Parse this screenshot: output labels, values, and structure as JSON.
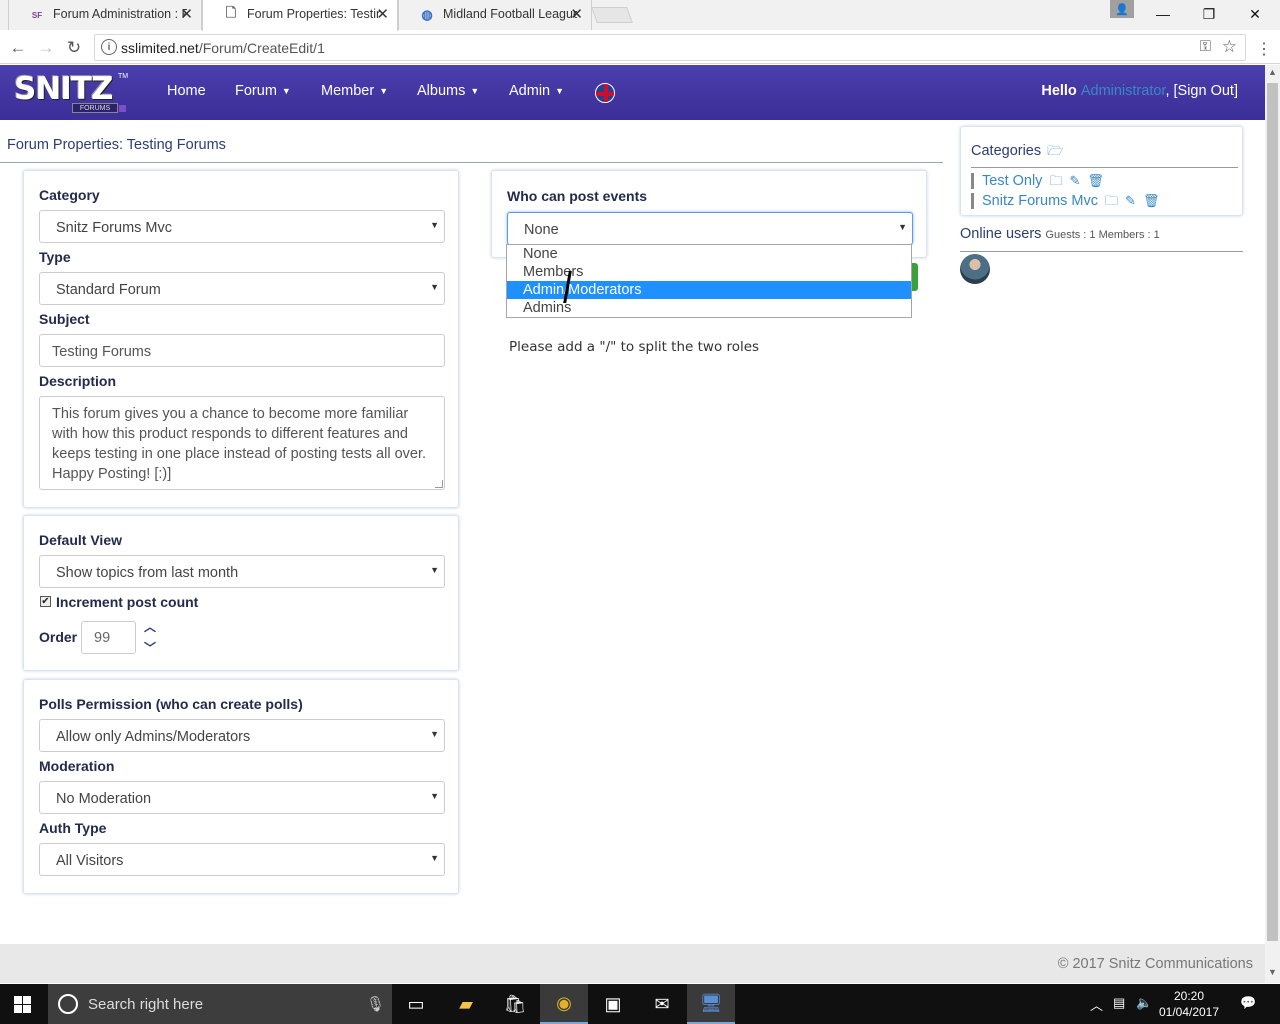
{
  "browser": {
    "tabs": [
      {
        "label": "Forum Administration : F",
        "favicon": "SF"
      },
      {
        "label": "Forum Properties: Testing",
        "active": true
      },
      {
        "label": "Midland Football League"
      }
    ],
    "url_domain": "sslimited.net",
    "url_path": "/Forum/CreateEdit/1"
  },
  "nav": {
    "logo_text": "SNITZ",
    "logo_sub": "FORUMS",
    "logo_tm": "TM",
    "items": [
      "Home",
      "Forum",
      "Member",
      "Albums",
      "Admin"
    ],
    "hello": "Hello",
    "user": "Administrator",
    "signout": ", [Sign Out]"
  },
  "page": {
    "title": "Forum Properties: Testing Forums"
  },
  "form": {
    "category_label": "Category",
    "category_value": "Snitz Forums Mvc",
    "type_label": "Type",
    "type_value": "Standard Forum",
    "subject_label": "Subject",
    "subject_value": "Testing Forums",
    "description_label": "Description",
    "description_value": "This forum gives you a chance to become more familiar with how this product responds to different features and keeps testing in one place instead of posting tests all over. Happy Posting! [:)]",
    "default_view_label": "Default View",
    "default_view_value": "Show topics from last month",
    "increment_label": "Increment post count",
    "increment_checked": true,
    "order_label": "Order",
    "order_value": "99",
    "polls_label": "Polls Permission (who can create polls)",
    "polls_value": "Allow only Admins/Moderators",
    "moderation_label": "Moderation",
    "moderation_value": "No Moderation",
    "auth_label": "Auth Type",
    "auth_value": "All Visitors",
    "events_label": "Who can post events",
    "events_value": "None",
    "events_options": [
      "None",
      "Members",
      "Admin/Moderators",
      "Admins"
    ],
    "events_highlighted": "Admin/Moderators",
    "hint": "Please add a \"/\" to split the two roles"
  },
  "sidebar": {
    "categories_label": "Categories",
    "categories": [
      "Test Only",
      "Snitz Forums Mvc"
    ],
    "online_label": "Online users",
    "online_counts": "Guests : 1 Members : 1"
  },
  "footer": {
    "copyright": "© 2017 Snitz Communications"
  },
  "taskbar": {
    "search_placeholder": "Search right here",
    "time": "20:20",
    "date": "01/04/2017"
  }
}
